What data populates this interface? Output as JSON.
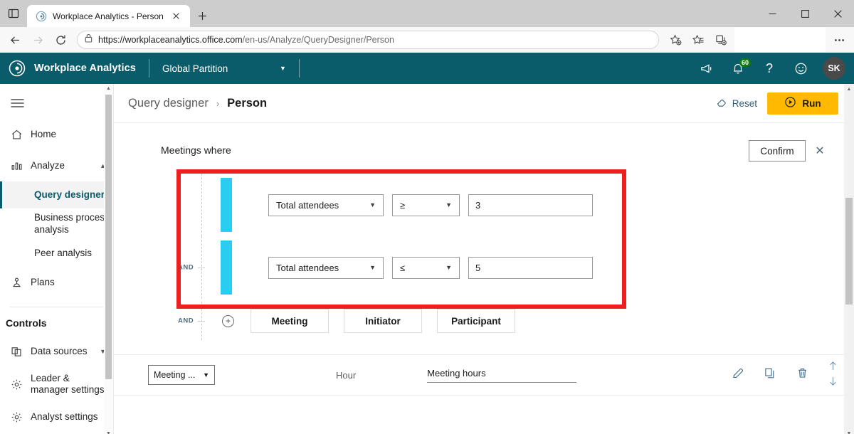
{
  "browser": {
    "tab": {
      "title": "Workplace Analytics - Person",
      "favicon_icon": "workplace-analytics-icon",
      "close_icon": "close-icon",
      "new_tab_icon": "plus-icon",
      "sidebar_toggle_icon": "sidebar-panel-icon"
    },
    "window": {
      "minimize_icon": "minimize-icon",
      "maximize_icon": "maximize-icon",
      "close_icon": "close-icon"
    },
    "toolbar": {
      "back_icon": "back-arrow-icon",
      "forward_icon": "forward-arrow-icon",
      "reload_icon": "reload-icon",
      "lock_icon": "lock-icon",
      "url_host": "https://workplaceanalytics.office.com",
      "url_path": "/en-us/Analyze/QueryDesigner/Person",
      "add_favorite_icon": "star-plus-icon",
      "favorites_icon": "favorites-list-icon",
      "collections_icon": "collections-icon",
      "settings_more_icon": "ellipsis-icon"
    }
  },
  "app_header": {
    "logo_icon": "workplace-analytics-logo-icon",
    "title": "Workplace Analytics",
    "partition_label": "Global Partition",
    "partition_caret_icon": "chevron-down-icon",
    "announcements_icon": "megaphone-icon",
    "notifications_icon": "bell-icon",
    "notifications_count": "60",
    "help_icon": "question-mark-icon",
    "feedback_icon": "smiley-icon",
    "avatar_initials": "SK",
    "accent_color": "#0b5c6b"
  },
  "sidebar": {
    "hamburger_icon": "hamburger-menu-icon",
    "items": [
      {
        "label": "Home",
        "icon": "home-icon"
      },
      {
        "label": "Analyze",
        "icon": "chart-bar-icon",
        "chevron": "chevron-up-icon"
      }
    ],
    "analyze_children": [
      {
        "label": "Query designer",
        "active": true
      },
      {
        "label": "Business process analysis",
        "active": false
      },
      {
        "label": "Peer analysis",
        "active": false
      }
    ],
    "plans": {
      "label": "Plans",
      "icon": "plans-icon"
    },
    "controls_label": "Controls",
    "controls_items": [
      {
        "label": "Data sources",
        "icon": "data-sources-icon",
        "chevron": "chevron-down-icon"
      },
      {
        "label": "Leader & manager settings",
        "icon": "gear-icon"
      },
      {
        "label": "Analyst settings",
        "icon": "gear-icon"
      }
    ],
    "scroll_up_icon": "scroll-up-arrow-icon",
    "scroll_down_icon": "scroll-down-arrow-icon"
  },
  "page": {
    "breadcrumb_parent": "Query designer",
    "breadcrumb_separator": "›",
    "breadcrumb_current": "Person",
    "reset_label": "Reset",
    "reset_icon": "eraser-icon",
    "run_label": "Run",
    "run_icon": "play-circle-icon",
    "run_color": "#ffb900"
  },
  "filter": {
    "title": "Meetings where",
    "confirm_label": "Confirm",
    "close_icon": "close-icon",
    "highlight_color": "#ee1f1f",
    "bar_color": "#29cdf0",
    "conditions": [
      {
        "conjunction": "",
        "attribute": "Total attendees",
        "operator": "≥",
        "value": "3",
        "attribute_caret_icon": "caret-down-icon",
        "operator_caret_icon": "caret-down-icon"
      },
      {
        "conjunction": "AND",
        "attribute": "Total attendees",
        "operator": "≤",
        "value": "5",
        "attribute_caret_icon": "caret-down-icon",
        "operator_caret_icon": "caret-down-icon"
      }
    ],
    "add_row": {
      "conjunction": "AND",
      "add_icon": "plus-circle-icon",
      "buttons": [
        "Meeting",
        "Initiator",
        "Participant"
      ]
    }
  },
  "metric_row": {
    "select_label": "Meeting ...",
    "select_caret_icon": "caret-down-icon",
    "period_label": "Hour",
    "metric_name": "Meeting hours",
    "edit_icon": "pencil-icon",
    "duplicate_icon": "copy-icon",
    "delete_icon": "trash-icon",
    "move_up_icon": "arrow-up-icon",
    "move_down_icon": "arrow-down-icon"
  },
  "main_scroll": {
    "up_icon": "scroll-up-arrow-icon",
    "down_icon": "scroll-down-arrow-icon"
  }
}
